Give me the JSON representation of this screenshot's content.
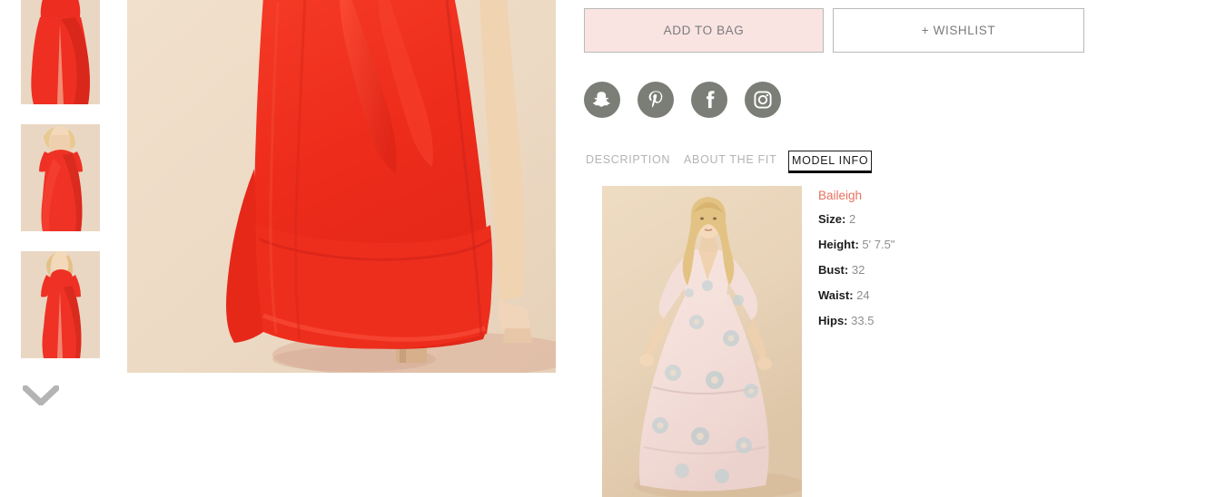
{
  "gallery": {
    "thumbnails": [
      {
        "name": "thumbnail-1",
        "alt": "Red wrap maxi dress front view"
      },
      {
        "name": "thumbnail-2",
        "alt": "Red wrap maxi dress side view"
      },
      {
        "name": "thumbnail-3",
        "alt": "Red wrap maxi dress full length view"
      }
    ],
    "next_arrow_icon": "chevron-down-icon",
    "main_image_alt": "Red maxi dress skirt and heels close up"
  },
  "actions": {
    "add_to_bag_label": "ADD TO BAG",
    "wishlist_label": "+ WISHLIST",
    "add_to_bag_bg": "#f9e4e2",
    "wishlist_bg": "#ffffff",
    "border_color": "#b9b9b9"
  },
  "social": {
    "items": [
      {
        "icon": "snapchat-icon",
        "label": "Snapchat"
      },
      {
        "icon": "pinterest-icon",
        "label": "Pinterest"
      },
      {
        "icon": "facebook-icon",
        "label": "Facebook"
      },
      {
        "icon": "instagram-icon",
        "label": "Instagram"
      }
    ],
    "circle_color": "#7b7d77"
  },
  "tabs": {
    "items": [
      {
        "label": "DESCRIPTION",
        "active": false
      },
      {
        "label": "ABOUT THE FIT",
        "active": false
      },
      {
        "label": "MODEL INFO",
        "active": true
      }
    ],
    "active_color": "#1c1c1c",
    "inactive_color": "#b3b3b3"
  },
  "model_info": {
    "image_alt": "Model Baileigh wearing pink floral maxi dress",
    "name": "Baileigh",
    "name_color": "#e8705f",
    "specs": [
      {
        "label": "Size:",
        "value": "2"
      },
      {
        "label": "Height:",
        "value": "5' 7.5\""
      },
      {
        "label": "Bust:",
        "value": "32"
      },
      {
        "label": "Waist:",
        "value": "24"
      },
      {
        "label": "Hips:",
        "value": "33.5"
      }
    ]
  }
}
